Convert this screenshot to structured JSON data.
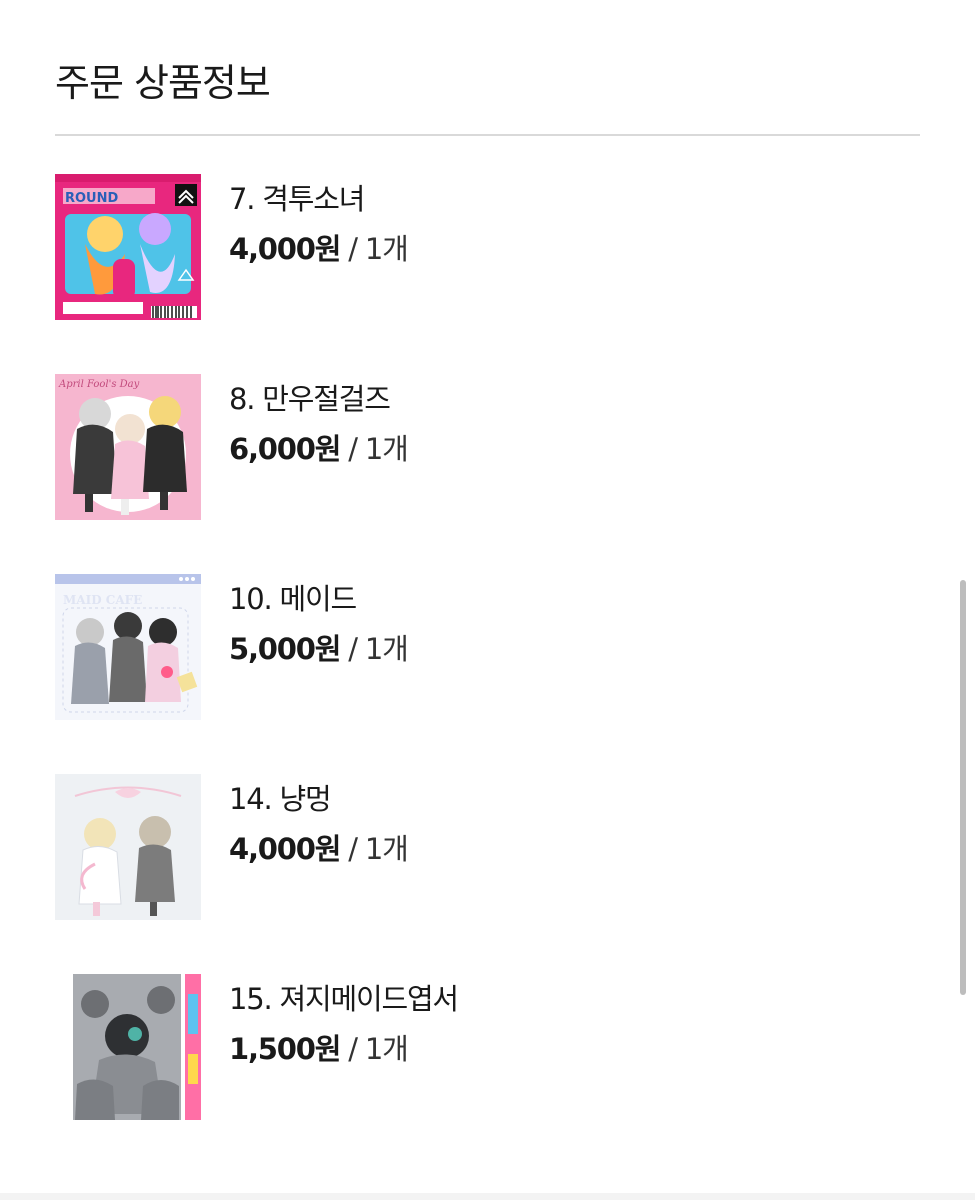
{
  "header": {
    "title": "주문 상품정보"
  },
  "items": [
    {
      "name": "7. 격투소녀",
      "price": "4,000원",
      "sep": " / ",
      "qty": "1개",
      "thumb_text": "ROUND"
    },
    {
      "name": "8. 만우절걸즈",
      "price": "6,000원",
      "sep": " / ",
      "qty": "1개",
      "thumb_text": "April Fool's Day"
    },
    {
      "name": "10. 메이드",
      "price": "5,000원",
      "sep": " / ",
      "qty": "1개",
      "thumb_text": "MAID CAFE"
    },
    {
      "name": "14. 냥멍",
      "price": "4,000원",
      "sep": " / ",
      "qty": "1개",
      "thumb_text": ""
    },
    {
      "name": "15. 져지메이드엽서",
      "price": "1,500원",
      "sep": " / ",
      "qty": "1개",
      "thumb_text": ""
    }
  ]
}
